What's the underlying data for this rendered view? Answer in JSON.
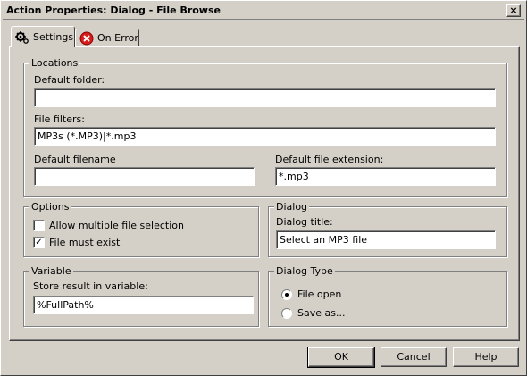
{
  "window": {
    "title": "Action Properties: Dialog - File Browse",
    "close_label": "×"
  },
  "tabs": [
    {
      "label": "Settings",
      "icon": "gear-icon"
    },
    {
      "label": "On Error",
      "icon": "error-icon"
    }
  ],
  "locations": {
    "group_label": "Locations",
    "default_folder_label": "Default folder:",
    "default_folder_value": "",
    "file_filters_label": "File filters:",
    "file_filters_value": "MP3s (*.MP3)|*.mp3",
    "default_filename_label": "Default filename",
    "default_filename_value": "",
    "default_extension_label": "Default file extension:",
    "default_extension_value": "*.mp3"
  },
  "options": {
    "group_label": "Options",
    "allow_multiple_label": "Allow multiple file selection",
    "allow_multiple_checked": false,
    "file_must_exist_label": "File must exist",
    "file_must_exist_checked": true
  },
  "dialog": {
    "group_label": "Dialog",
    "title_label": "Dialog title:",
    "title_value": "Select an MP3 file"
  },
  "variable": {
    "group_label": "Variable",
    "store_label": "Store result in variable:",
    "store_value": "%FullPath%"
  },
  "dialog_type": {
    "group_label": "Dialog Type",
    "file_open_label": "File open",
    "save_as_label": "Save as...",
    "selected": "file_open"
  },
  "buttons": {
    "ok": "OK",
    "cancel": "Cancel",
    "help": "Help"
  }
}
